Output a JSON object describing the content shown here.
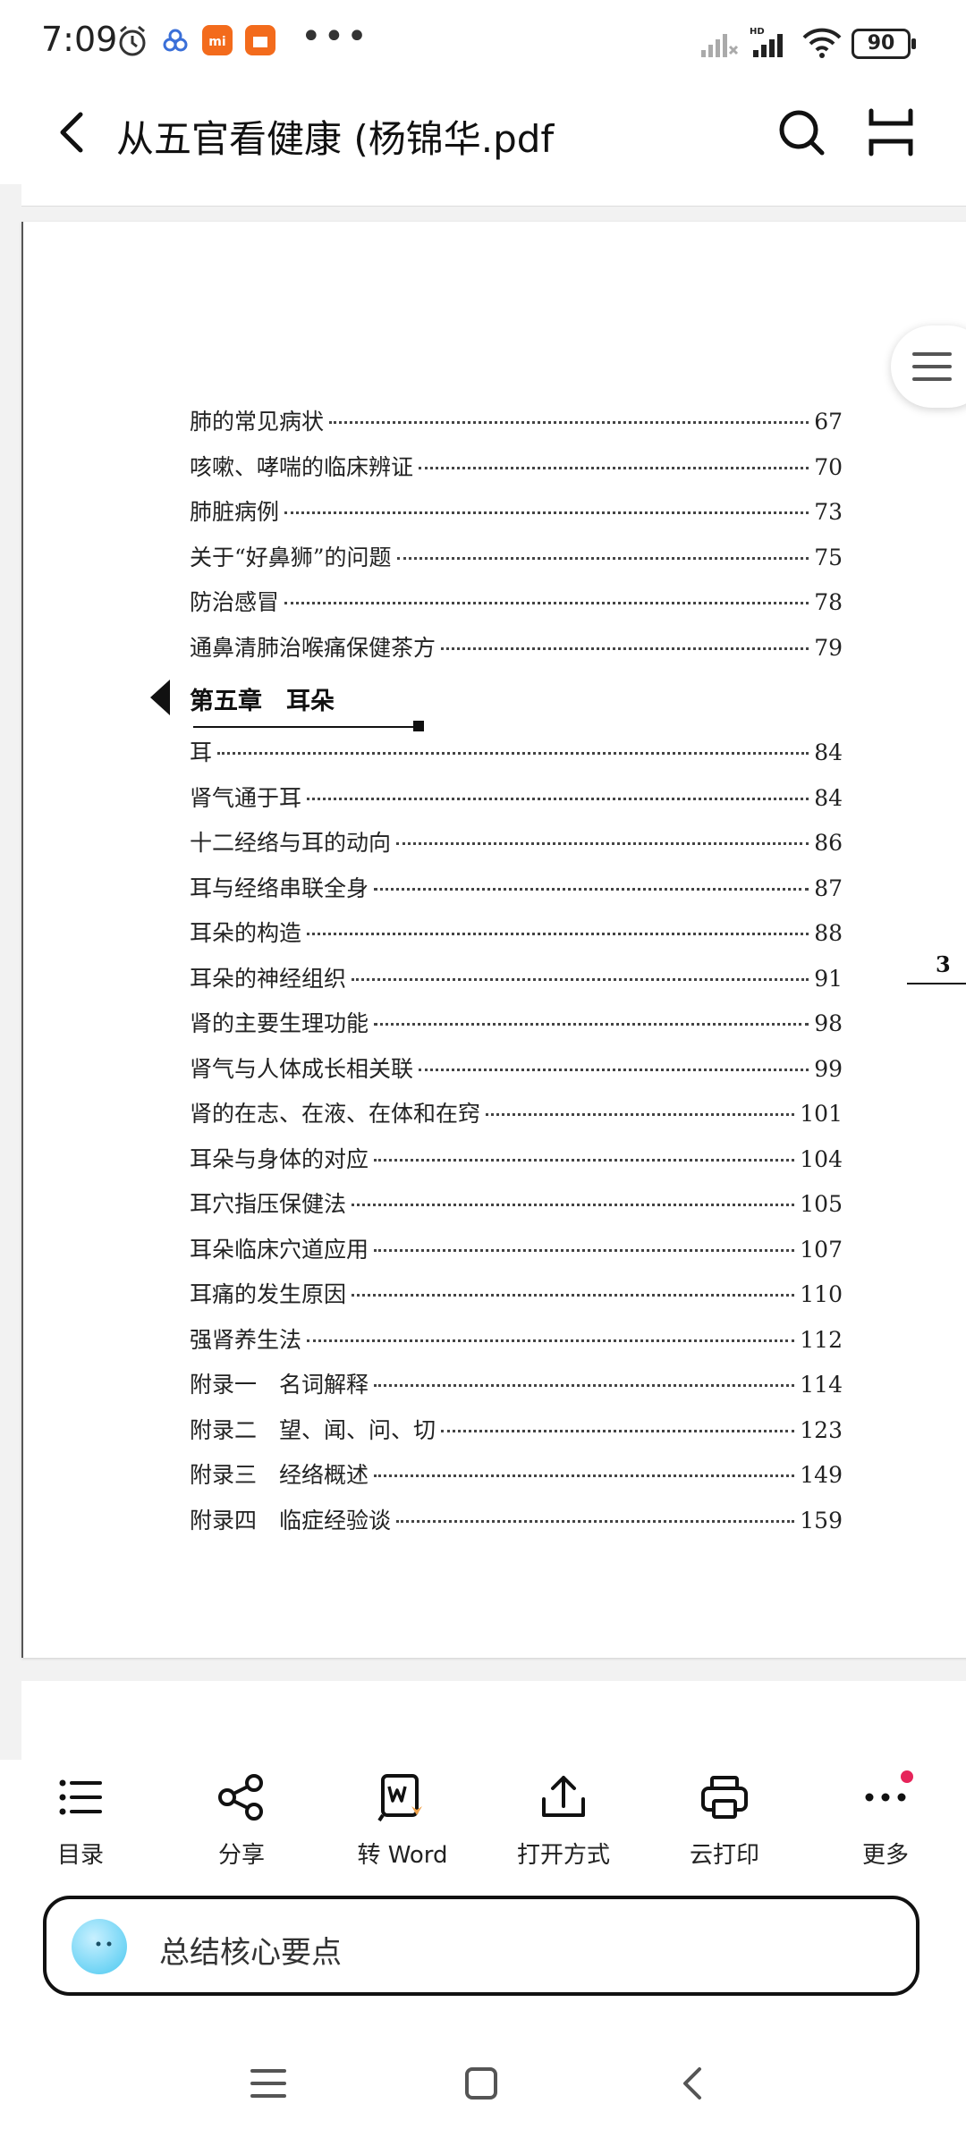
{
  "status_bar": {
    "time": "7:09",
    "battery": "90",
    "more_indicator": "•••"
  },
  "header": {
    "title": "从五官看健康 (杨锦华.pdf",
    "back_icon": "chevron-left-icon",
    "search_icon": "search-icon",
    "layout_icon": "page-layout-icon"
  },
  "page": {
    "chapter_heading": "第五章　耳朵",
    "page_number": "3",
    "toc": [
      {
        "title": "肺的常见病状",
        "page": "67"
      },
      {
        "title": "咳嗽、哮喘的临床辨证",
        "page": "70"
      },
      {
        "title": "肺脏病例",
        "page": "73"
      },
      {
        "title": "关于“好鼻狮”的问题",
        "page": "75"
      },
      {
        "title": "防治感冒",
        "page": "78"
      },
      {
        "title": "通鼻清肺治喉痛保健茶方",
        "page": "79"
      },
      {
        "title": "耳",
        "page": "84"
      },
      {
        "title": "肾气通于耳",
        "page": "84"
      },
      {
        "title": "十二经络与耳的动向",
        "page": "86"
      },
      {
        "title": "耳与经络串联全身",
        "page": "87"
      },
      {
        "title": "耳朵的构造",
        "page": "88"
      },
      {
        "title": "耳朵的神经组织",
        "page": "91"
      },
      {
        "title": "肾的主要生理功能",
        "page": "98"
      },
      {
        "title": "肾气与人体成长相关联",
        "page": "99"
      },
      {
        "title": "肾的在志、在液、在体和在窍",
        "page": "101"
      },
      {
        "title": "耳朵与身体的对应",
        "page": "104"
      },
      {
        "title": "耳穴指压保健法",
        "page": "105"
      },
      {
        "title": "耳朵临床穴道应用",
        "page": "107"
      },
      {
        "title": "耳痛的发生原因",
        "page": "110"
      },
      {
        "title": "强肾养生法",
        "page": "112"
      },
      {
        "title": "附录一　名词解释",
        "page": "114"
      },
      {
        "title": "附录二　望、闻、问、切",
        "page": "123"
      },
      {
        "title": "附录三　经络概述",
        "page": "149"
      },
      {
        "title": "附录四　临症经验谈",
        "page": "159"
      }
    ]
  },
  "toolbar": {
    "items": [
      {
        "label": "目录",
        "icon": "list-icon"
      },
      {
        "label": "分享",
        "icon": "share-icon"
      },
      {
        "label": "转 Word",
        "icon": "word-convert-icon"
      },
      {
        "label": "打开方式",
        "icon": "open-with-icon"
      },
      {
        "label": "云打印",
        "icon": "printer-icon"
      },
      {
        "label": "更多",
        "icon": "more-icon"
      }
    ],
    "accent_color": "#e6245a"
  },
  "ai_bar": {
    "text": "总结核心要点"
  }
}
